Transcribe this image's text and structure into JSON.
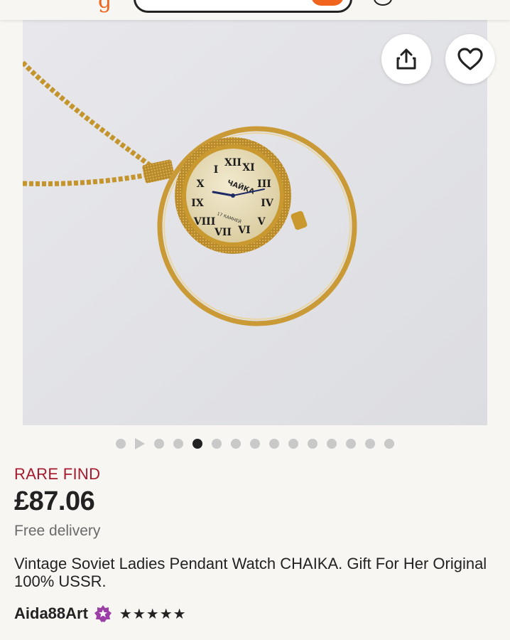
{
  "listing": {
    "badge": "RARE FIND",
    "price": "£87.06",
    "delivery": "Free delivery",
    "title": "Vintage Soviet Ladies Pendant Watch CHAIKA. Gift For Her Original 100% USSR."
  },
  "seller": {
    "name": "Aida88Art",
    "rating_stars": "★★★★★",
    "rating": 5
  },
  "gallery": {
    "total_items": 15,
    "active_index": 4,
    "video_index": 1,
    "watch_brand_text": "ЧАЙКА",
    "watch_dial_text": "17 КАМНЕЙ"
  },
  "colors": {
    "badge": "#a61a2e",
    "accent": "#f1641e",
    "star_seller": "#9b3fa6"
  }
}
